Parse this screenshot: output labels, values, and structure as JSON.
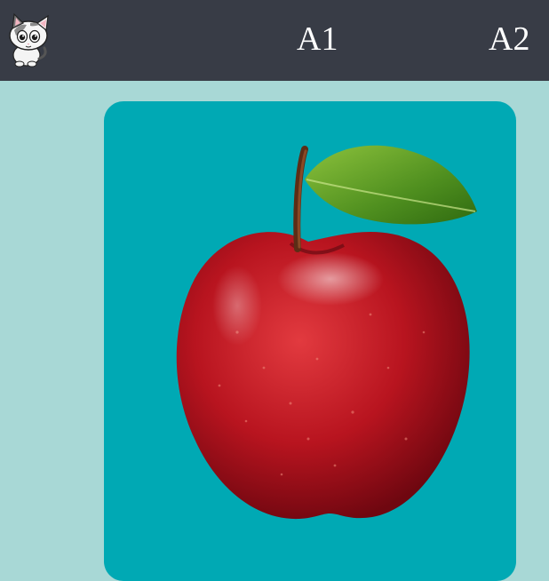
{
  "header": {
    "logo_icon": "cat-logo-icon",
    "nav": [
      {
        "label": "A1"
      },
      {
        "label": "A2"
      }
    ]
  },
  "main": {
    "card": {
      "image_icon": "red-apple-image",
      "background": "#00a9b4"
    }
  },
  "colors": {
    "header_bg": "#383c46",
    "page_bg": "#a8d8d6",
    "card_bg": "#00a9b4"
  }
}
